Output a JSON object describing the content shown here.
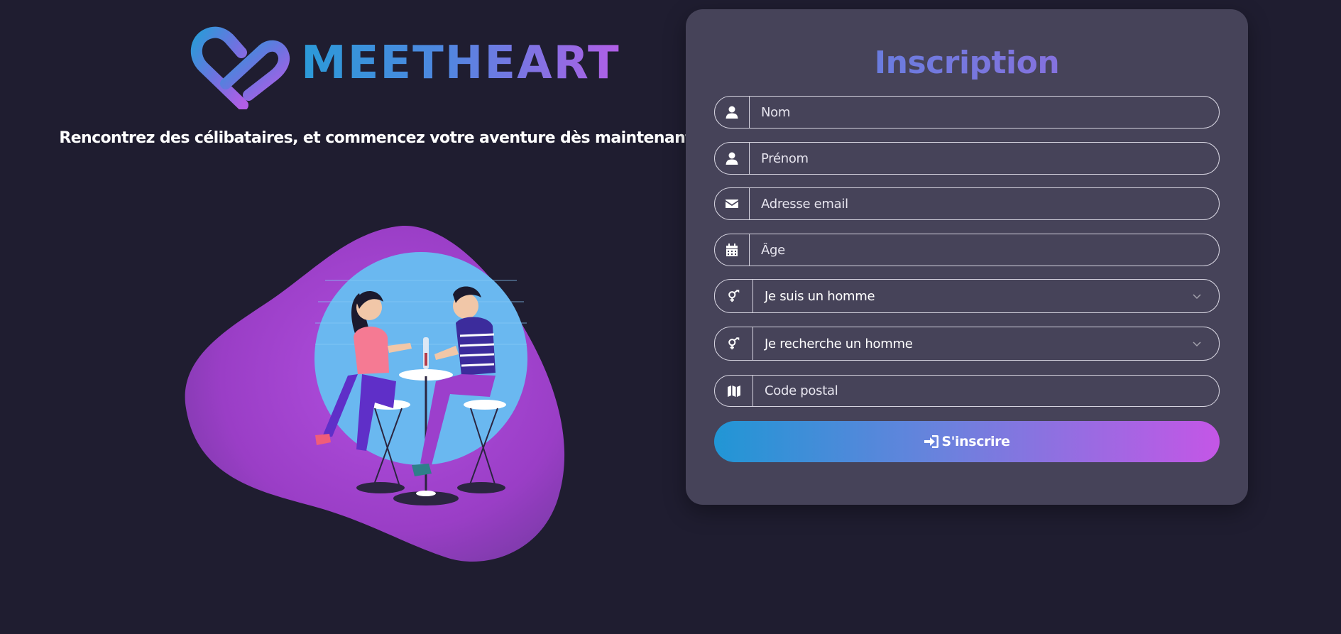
{
  "brand": {
    "name": "MEETHEART",
    "logo_icon": "heart-link-icon",
    "gradient": [
      "#2b9ad8",
      "#b25ee6"
    ]
  },
  "tagline": "Rencontrez des célibataires, et commencez votre aventure dès maintenant !",
  "illustration_icon": "couple-date-illustration",
  "form": {
    "title": "Inscription",
    "fields": {
      "nom": {
        "icon": "user-icon",
        "placeholder": "Nom"
      },
      "prenom": {
        "icon": "user-icon",
        "placeholder": "Prénom"
      },
      "email": {
        "icon": "envelope-icon",
        "placeholder": "Adresse email"
      },
      "age": {
        "icon": "calendar-icon",
        "placeholder": "Âge"
      },
      "genre": {
        "icon": "gender-icon",
        "selected": "Je suis un homme"
      },
      "recherche": {
        "icon": "gender-icon",
        "selected": "Je recherche un homme"
      },
      "code_postal": {
        "icon": "map-icon",
        "placeholder": "Code postal"
      }
    },
    "submit_label": "S'inscrire",
    "submit_icon": "sign-in-icon"
  },
  "colors": {
    "background": "#1f1d30",
    "card": "#464359",
    "accent_start": "#2196d5",
    "accent_end": "#c456e6"
  }
}
